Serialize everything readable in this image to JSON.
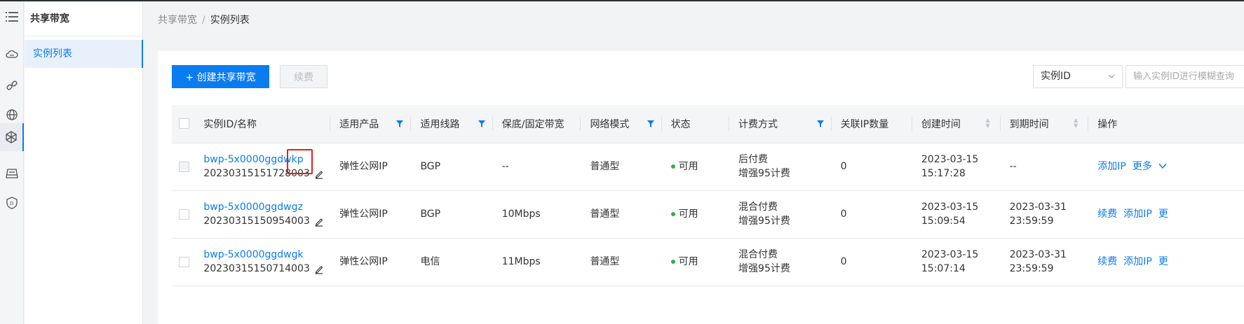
{
  "breadcrumb": {
    "parent": "共享带宽",
    "separator": "/",
    "current": "实例列表"
  },
  "sidebar": {
    "title": "共享带宽",
    "items": [
      {
        "label": "实例列表",
        "active": true
      }
    ]
  },
  "icon_bar": [
    "menu-icon",
    "cloud-icon",
    "link-icon",
    "globe-icon",
    "network-icon",
    "storage-icon",
    "shield-icon"
  ],
  "toolbar": {
    "create_label": "+ 创建共享带宽",
    "renew_label": "续费",
    "filter_select_value": "实例ID",
    "search_placeholder": "输入实例ID进行模糊查询"
  },
  "table": {
    "headers": [
      "实例ID/名称",
      "适用产品",
      "适用线路",
      "保底/固定带宽",
      "网络模式",
      "状态",
      "计费方式",
      "关联IP数量",
      "创建时间",
      "到期时间",
      "操作"
    ],
    "rows": [
      {
        "id": "bwp-5x0000ggdwkp",
        "name": "20230315151728003",
        "product": "弹性公网IP",
        "line": "BGP",
        "bandwidth": "--",
        "mode": "普通型",
        "status": "可用",
        "billing1": "后付费",
        "billing2": "增强95计费",
        "ip_count": "0",
        "created_date": "2023-03-15",
        "created_time": "15:17:28",
        "expire_date": "--",
        "expire_time": "",
        "ops": [
          "添加IP",
          "更多"
        ]
      },
      {
        "id": "bwp-5x0000ggdwgz",
        "name": "20230315150954003",
        "product": "弹性公网IP",
        "line": "BGP",
        "bandwidth": "10Mbps",
        "mode": "普通型",
        "status": "可用",
        "billing1": "混合付费",
        "billing2": "增强95计费",
        "ip_count": "0",
        "created_date": "2023-03-15",
        "created_time": "15:09:54",
        "expire_date": "2023-03-31",
        "expire_time": "23:59:59",
        "ops": [
          "续费",
          "添加IP",
          "更"
        ]
      },
      {
        "id": "bwp-5x0000ggdwgk",
        "name": "20230315150714003",
        "product": "弹性公网IP",
        "line": "电信",
        "bandwidth": "11Mbps",
        "mode": "普通型",
        "status": "可用",
        "billing1": "混合付费",
        "billing2": "增强95计费",
        "ip_count": "0",
        "created_date": "2023-03-15",
        "created_time": "15:07:14",
        "expire_date": "2023-03-31",
        "expire_time": "23:59:59",
        "ops": [
          "续费",
          "添加IP",
          "更"
        ]
      }
    ]
  },
  "colors": {
    "accent": "#0b7cf0",
    "status_ok": "#2bb44a",
    "highlight": "#e02020"
  }
}
